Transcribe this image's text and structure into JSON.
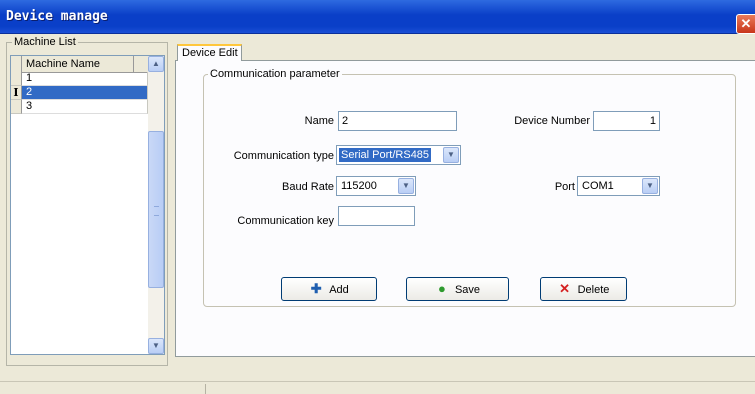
{
  "window": {
    "title": "Device manage"
  },
  "machine_list": {
    "group_label": "Machine List",
    "column_header": "Machine Name",
    "rows": [
      {
        "name": "1",
        "selected": false
      },
      {
        "name": "2",
        "selected": true
      },
      {
        "name": "3",
        "selected": false
      }
    ]
  },
  "tabs": [
    {
      "label": "Device Edit",
      "active": true
    }
  ],
  "comm": {
    "group_label": "Communication parameter",
    "name_label": "Name",
    "name_value": "2",
    "device_number_label": "Device Number",
    "device_number_value": "1",
    "comm_type_label": "Communication type",
    "comm_type_value": "Serial Port/RS485",
    "baud_rate_label": "Baud Rate",
    "baud_rate_value": "115200",
    "port_label": "Port",
    "port_value": "COM1",
    "comm_key_label": "Communication key",
    "comm_key_value": ""
  },
  "buttons": {
    "add": "Add",
    "save": "Save",
    "delete": "Delete"
  },
  "icons": {
    "close": "close-icon",
    "add": "plus-icon",
    "save": "check-icon",
    "delete": "x-icon",
    "dropdown": "chevron-down-icon"
  },
  "colors": {
    "titlebar": "#0a3fc8",
    "selection": "#316ac5",
    "dialog": "#ece9d8"
  }
}
